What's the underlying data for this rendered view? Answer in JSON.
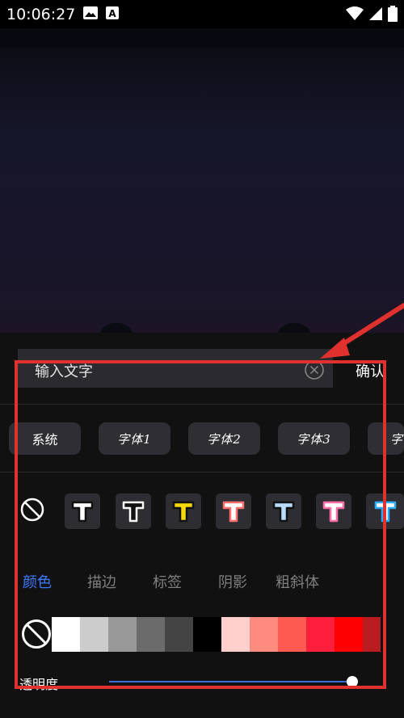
{
  "status_bar": {
    "time": "10:06:27",
    "icons": [
      "image-icon",
      "text-a-icon",
      "wifi-icon",
      "signal-icon",
      "battery-icon"
    ]
  },
  "text_input": {
    "placeholder": "输入文字",
    "confirm_label": "确认"
  },
  "font_options": [
    "系统",
    "字体1",
    "字体2",
    "字体3",
    "字"
  ],
  "text_styles": [
    {
      "fill": "#ffffff",
      "stroke": "#111111"
    },
    {
      "fill": "#111111",
      "stroke": "#ffffff"
    },
    {
      "fill": "#f5d90a",
      "stroke": "#111111"
    },
    {
      "fill": "#ffffff",
      "stroke": "#ff6d6d"
    },
    {
      "fill": "#b9dcff",
      "stroke": "#111111"
    },
    {
      "fill": "#ffffff",
      "stroke": "#ff6ea8"
    },
    {
      "fill": "#ffffff",
      "stroke": "#2aa9ff"
    }
  ],
  "tabs": [
    "颜色",
    "描边",
    "标签",
    "阴影",
    "粗斜体"
  ],
  "active_tab": "颜色",
  "color_swatches": [
    "#ffffff",
    "#cccccc",
    "#999999",
    "#6b6b6b",
    "#444444",
    "#000000",
    "#ffd0cc",
    "#ff8a80",
    "#ff5a52",
    "#ff1e3c",
    "#ff0000",
    "#b81c20"
  ],
  "opacity": {
    "label": "透明度",
    "value": 1.0
  },
  "accent_color": "#3d7bff",
  "annotation_color": "#e0312e"
}
